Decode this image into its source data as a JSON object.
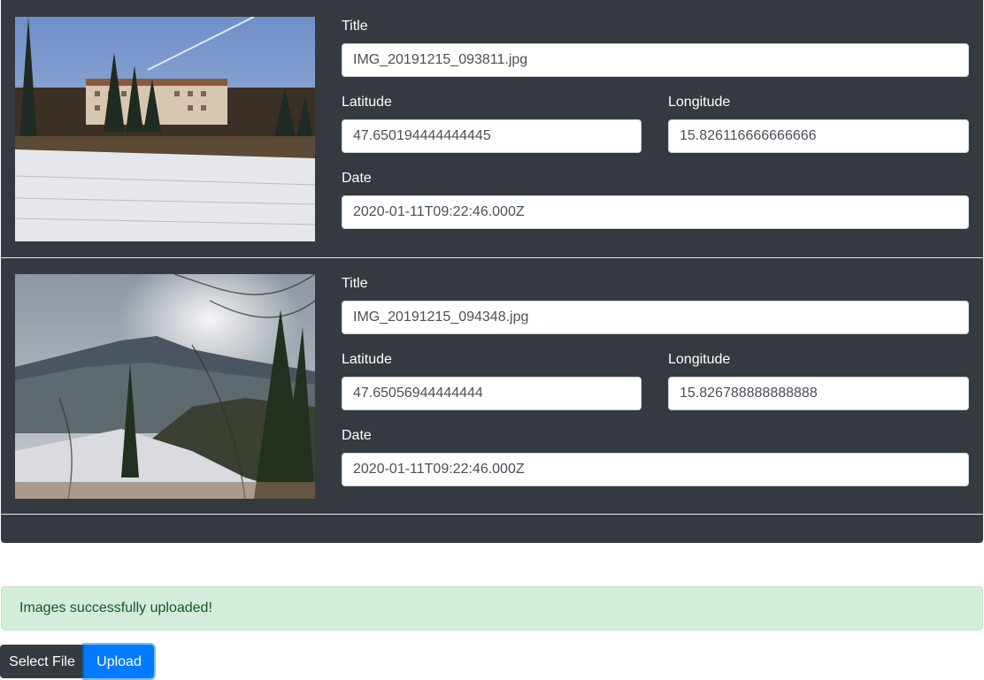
{
  "entries": [
    {
      "title_label": "Title",
      "title_value": "IMG_20191215_093811.jpg",
      "latitude_label": "Latitude",
      "latitude_value": "47.650194444444445",
      "longitude_label": "Longitude",
      "longitude_value": "15.826116666666666",
      "date_label": "Date",
      "date_value": "2020-01-11T09:22:46.000Z"
    },
    {
      "title_label": "Title",
      "title_value": "IMG_20191215_094348.jpg",
      "latitude_label": "Latitude",
      "latitude_value": "47.65056944444444",
      "longitude_label": "Longitude",
      "longitude_value": "15.826788888888888",
      "date_label": "Date",
      "date_value": "2020-01-11T09:22:46.000Z"
    }
  ],
  "alert": {
    "message": "Images successfully uploaded!",
    "color": "#155724",
    "background": "#d4edda"
  },
  "actions": {
    "select_label": "Select File",
    "upload_label": "Upload"
  },
  "colors": {
    "panel": "#343a40",
    "primary": "#007bff"
  }
}
